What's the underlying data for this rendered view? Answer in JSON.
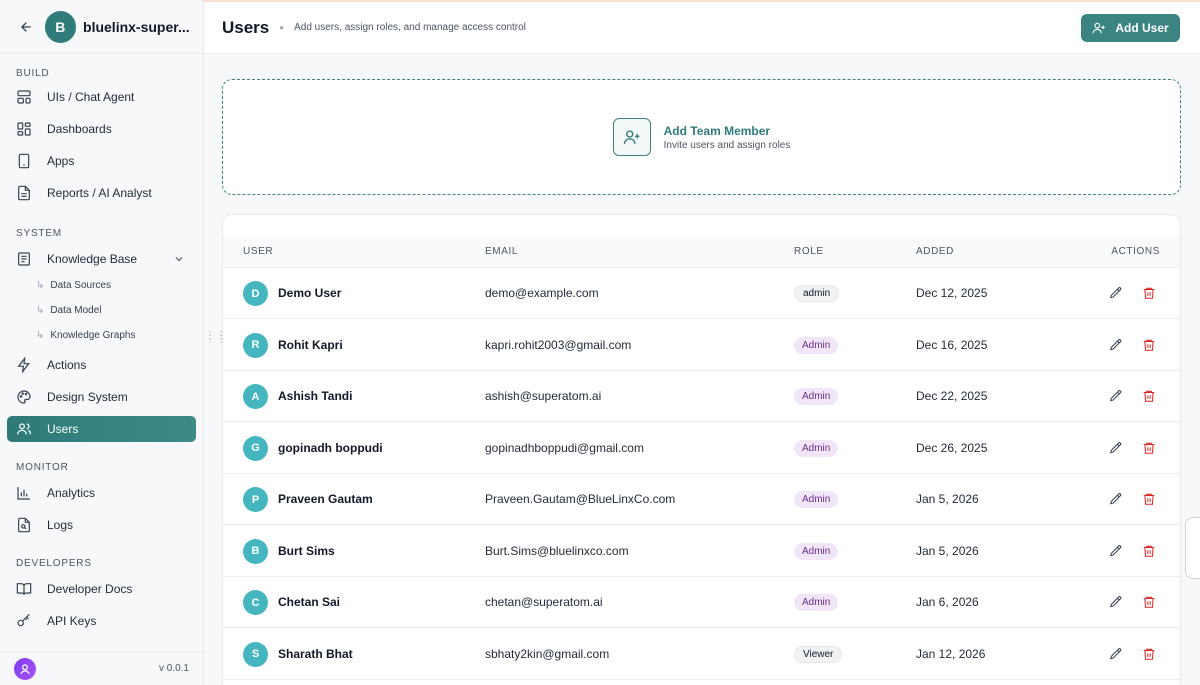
{
  "workspace": {
    "avatar_letter": "B",
    "name": "bluelinx-super..."
  },
  "sidebar": {
    "sections": {
      "build": "BUILD",
      "system": "SYSTEM",
      "monitor": "MONITOR",
      "developers": "DEVELOPERS"
    },
    "items": {
      "uis_chat_agent": "UIs / Chat Agent",
      "dashboards": "Dashboards",
      "apps": "Apps",
      "reports": "Reports / AI Analyst",
      "knowledge_base": "Knowledge Base",
      "data_sources": "Data Sources",
      "data_model": "Data Model",
      "knowledge_graphs": "Knowledge Graphs",
      "actions": "Actions",
      "design_system": "Design System",
      "users": "Users",
      "analytics": "Analytics",
      "logs": "Logs",
      "developer_docs": "Developer Docs",
      "api_keys": "API Keys"
    },
    "version": "v 0.0.1"
  },
  "header": {
    "title": "Users",
    "subtitle": "Add users, assign roles, and manage access control",
    "add_user_label": "Add User"
  },
  "add_member": {
    "title": "Add Team Member",
    "subtitle": "Invite users and assign roles"
  },
  "table": {
    "columns": {
      "user": "USER",
      "email": "EMAIL",
      "role": "ROLE",
      "added": "ADDED",
      "actions": "ACTIONS"
    },
    "rows": [
      {
        "initial": "D",
        "name": "Demo User",
        "email": "demo@example.com",
        "role": "admin",
        "added": "Dec 12, 2025"
      },
      {
        "initial": "R",
        "name": "Rohit Kapri",
        "email": "kapri.rohit2003@gmail.com",
        "role": "Admin",
        "added": "Dec 16, 2025"
      },
      {
        "initial": "A",
        "name": "Ashish Tandi",
        "email": "ashish@superatom.ai",
        "role": "Admin",
        "added": "Dec 22, 2025"
      },
      {
        "initial": "G",
        "name": "gopinadh boppudi",
        "email": "gopinadhboppudi@gmail.com",
        "role": "Admin",
        "added": "Dec 26, 2025"
      },
      {
        "initial": "P",
        "name": "Praveen Gautam",
        "email": "Praveen.Gautam@BlueLinxCo.com",
        "role": "Admin",
        "added": "Jan 5, 2026"
      },
      {
        "initial": "B",
        "name": "Burt Sims",
        "email": "Burt.Sims@bluelinxco.com",
        "role": "Admin",
        "added": "Jan 5, 2026"
      },
      {
        "initial": "C",
        "name": "Chetan Sai",
        "email": "chetan@superatom.ai",
        "role": "Admin",
        "added": "Jan 6, 2026"
      },
      {
        "initial": "S",
        "name": "Sharath Bhat",
        "email": "sbhaty2kin@gmail.com",
        "role": "Viewer",
        "added": "Jan 12, 2026"
      }
    ]
  },
  "colors": {
    "accent": "#3a8582",
    "delete": "#dc2626",
    "avatar": "#45b6c0"
  }
}
